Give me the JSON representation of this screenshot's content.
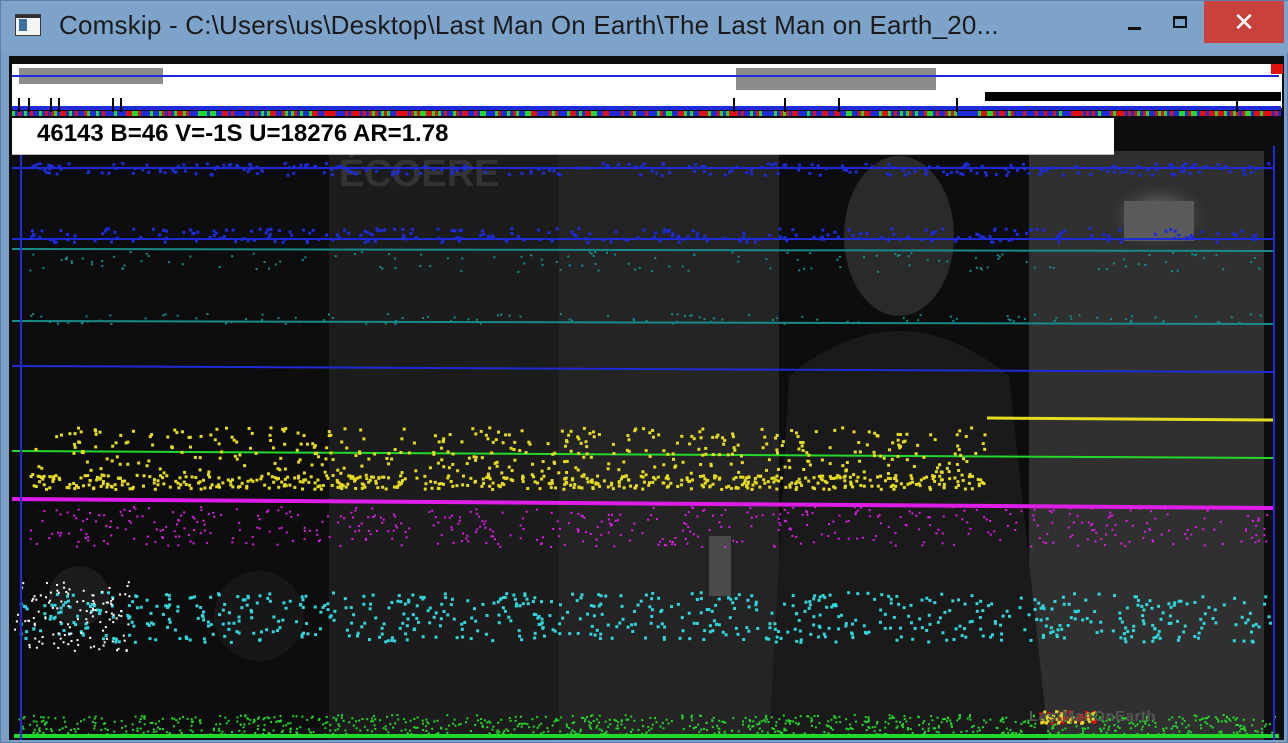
{
  "window": {
    "title": "Comskip - C:\\Users\\us\\Desktop\\Last Man On Earth\\The Last Man on Earth_20...",
    "minimize_label": "",
    "maximize_label": "",
    "close_label": "✕"
  },
  "overlay": {
    "info_text": "46143 B=46  V=-1S U=18276  AR=1.78",
    "watermark": "LastManOnEarth"
  },
  "colors": {
    "blue": "#1e2bd8",
    "teal": "#178a8a",
    "yellow": "#e6dc1e",
    "green": "#22d82a",
    "magenta": "#e01de8",
    "cyan": "#2fd6dc",
    "title_bar": "#7ea3cb",
    "close_red": "#c8413c"
  }
}
